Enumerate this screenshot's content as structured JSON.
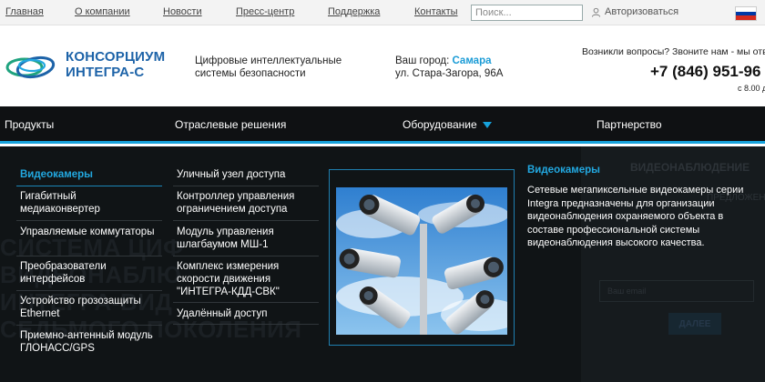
{
  "topbar": {
    "links": [
      "Главная",
      "О компании",
      "Новости",
      "Пресс-центр",
      "Поддержка",
      "Контакты"
    ],
    "search_placeholder": "Поиск...",
    "login_label": "Авторизоваться",
    "flag_colors": [
      "#ffffff",
      "#0039a6",
      "#d52b1e"
    ]
  },
  "header": {
    "brand_line1": "КОНСОРЦИУМ",
    "brand_line2": "ИНТЕГРА-С",
    "tagline_line1": "Цифровые интеллектуальные",
    "tagline_line2": "системы безопасности",
    "city_label": "Ваш город:",
    "city_name": "Самара",
    "address": "ул. Стара-Загора, 96А",
    "question": "Возникли вопросы? Звоните нам - мы отв",
    "phone": "+7 (846) 951-96",
    "hours": "с 8.00 д"
  },
  "nav": {
    "items": [
      "Продукты",
      "Отраслевые решения",
      "Оборудование",
      "Партнерство"
    ]
  },
  "dropdown": {
    "col1": [
      "Видеокамеры",
      "Гигабитный медиаконвертер",
      "Управляемые коммутаторы",
      "Преобразователи интерфейсов",
      "Устройство грозозащиты Ethernet",
      "Приемно-антенный модуль ГЛОНАСС/GPS"
    ],
    "col2": [
      "Уличный узел доступа",
      "Контроллер управления ограничением доступа",
      "Модуль управления шлагбаумом МШ-1",
      "Комплекс измерения скорости движения \"ИНТЕГРА-КДД-СВК\"",
      "Удалённый доступ"
    ],
    "desc_title": "Видеокамеры",
    "desc_text": "Сетевые мегапиксельные видеокамеры серии Integra предназначены для организации видеонаблюдения охраняемого объекта в составе профессиональной системы видеонаблюдения высокого качества."
  },
  "background": {
    "text_line1": "СИСТЕМА ЦИФ",
    "text_line2": "ВИДЕОНАБЛЮ",
    "text_line3": "ИНТЕГРА-ВИД",
    "text_line4": "СЕДЬМОГО ПОКОЛЕНИЯ",
    "card_title": "ВИДЕОНАБЛЮДЕНИЕ",
    "card_sub": "ПРЕДЛОЖЕН",
    "card_field": "Ваш email",
    "card_button": "ДАЛЕЕ"
  },
  "colors": {
    "accent": "#16a2dc",
    "nav_bg": "#0f1113",
    "brand": "#1d63a8"
  }
}
